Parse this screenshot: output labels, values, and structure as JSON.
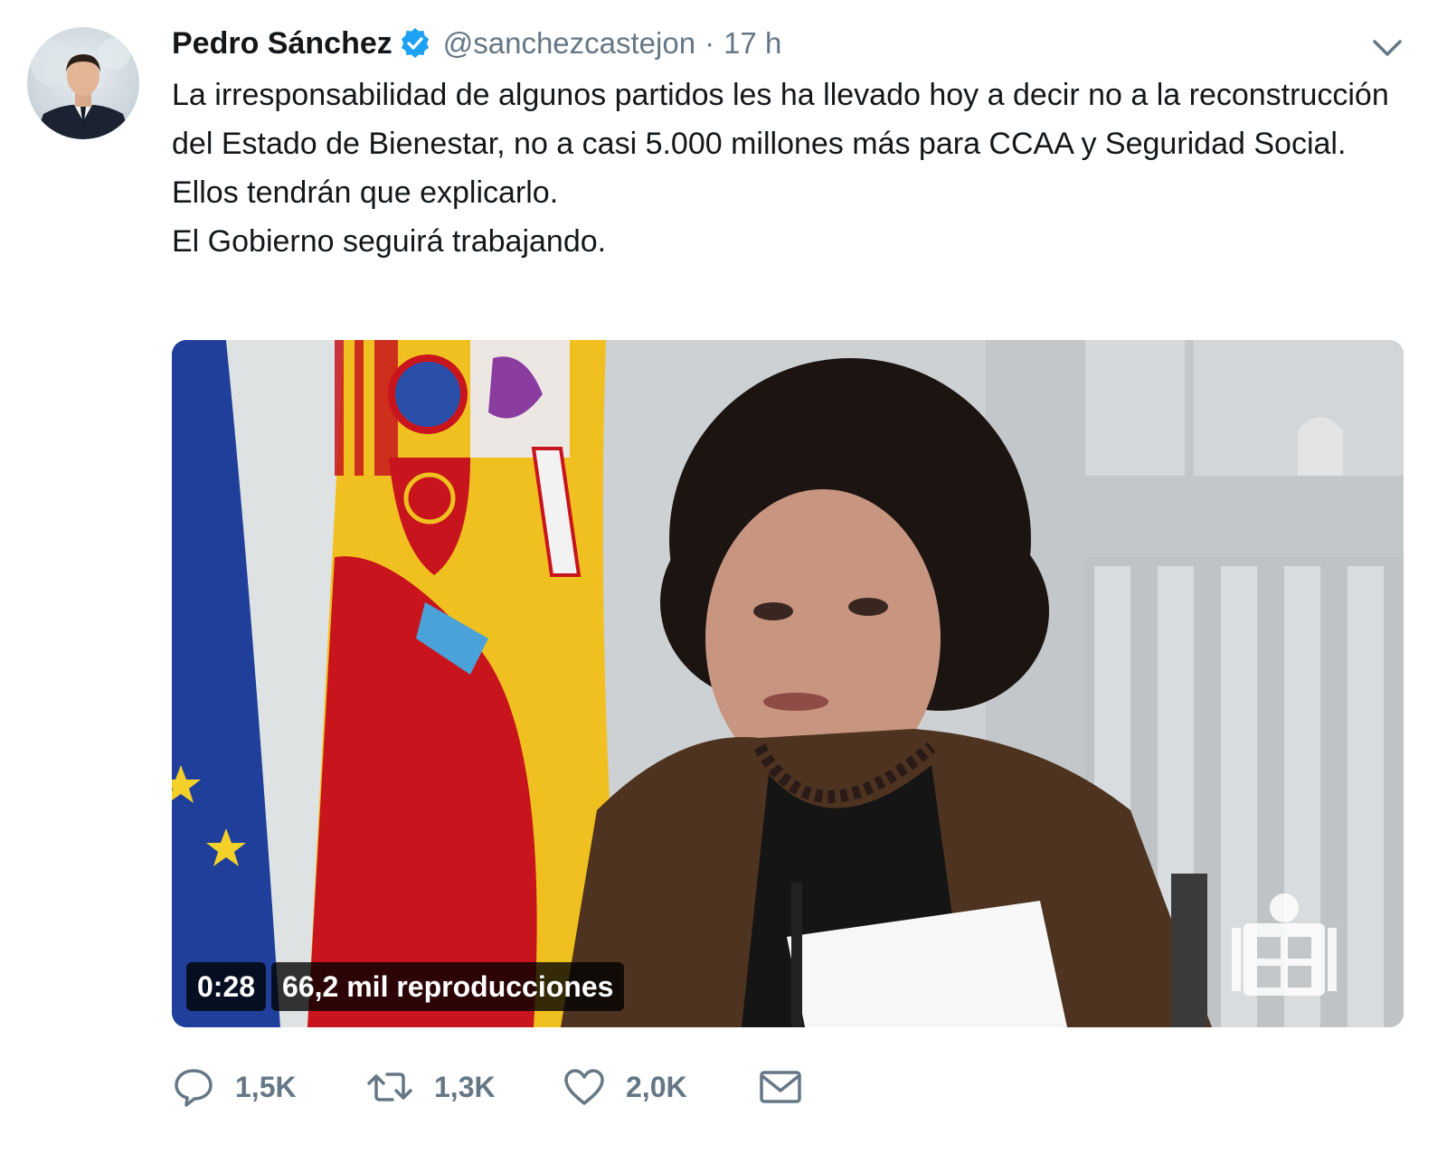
{
  "tweet": {
    "author_name": "Pedro Sánchez",
    "handle": "@sanchezcastejon",
    "separator": "·",
    "time": "17 h",
    "text_lines": [
      "La irresponsabilidad de algunos partidos les ha llevado hoy a decir no a la reconstrucción del Estado de Bienestar, no a casi 5.000 millones más para CCAA y Seguridad Social.",
      "Ellos tendrán que explicarlo.",
      "El Gobierno seguirá trabajando."
    ],
    "video": {
      "duration": "0:28",
      "views": "66,2 mil reproducciones"
    },
    "actions": {
      "replies": "1,5K",
      "retweets": "1,3K",
      "likes": "2,0K"
    },
    "icons": {
      "verified": "verified-badge-icon",
      "more": "chevron-down-icon",
      "reply": "reply-icon",
      "retweet": "retweet-icon",
      "like": "heart-icon",
      "message": "envelope-icon"
    },
    "colors": {
      "name": "#14171a",
      "secondary": "#657786",
      "verified": "#1da1f2"
    }
  }
}
